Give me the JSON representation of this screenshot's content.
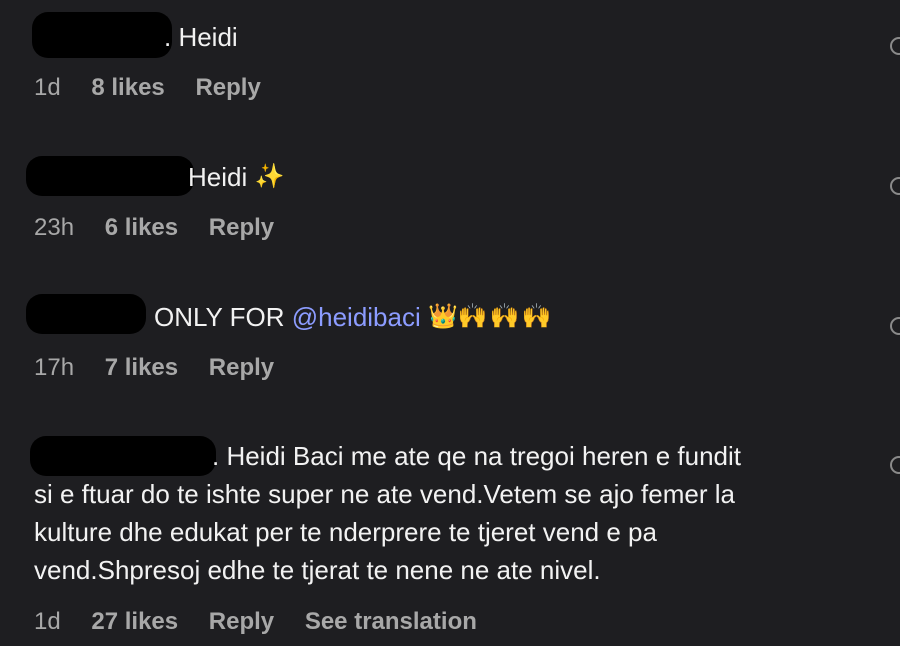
{
  "comments": [
    {
      "text": ". Heidi",
      "emoji": "",
      "time": "1d",
      "likes": "8 likes",
      "reply": "Reply"
    },
    {
      "text": "Heidi",
      "emoji": "✨",
      "time": "23h",
      "likes": "6 likes",
      "reply": "Reply"
    },
    {
      "text": "ONLY FOR ",
      "mention": "@heidibaci",
      "crown": "👑",
      "hands": "🙌🙌🙌",
      "time": "17h",
      "likes": "7 likes",
      "reply": "Reply"
    },
    {
      "line1": ". Heidi Baci me ate qe na tregoi heren e fundit",
      "line2": "si e ftuar do te ishte super ne ate vend.Vetem se ajo femer la",
      "line3": "kulture dhe edukat per te nderprere te tjeret vend e pa",
      "line4": "vend.Shpresoj edhe te tjerat te nene ne ate nivel.",
      "time": "1d",
      "likes": "27 likes",
      "reply": "Reply",
      "translate": "See translation"
    }
  ]
}
